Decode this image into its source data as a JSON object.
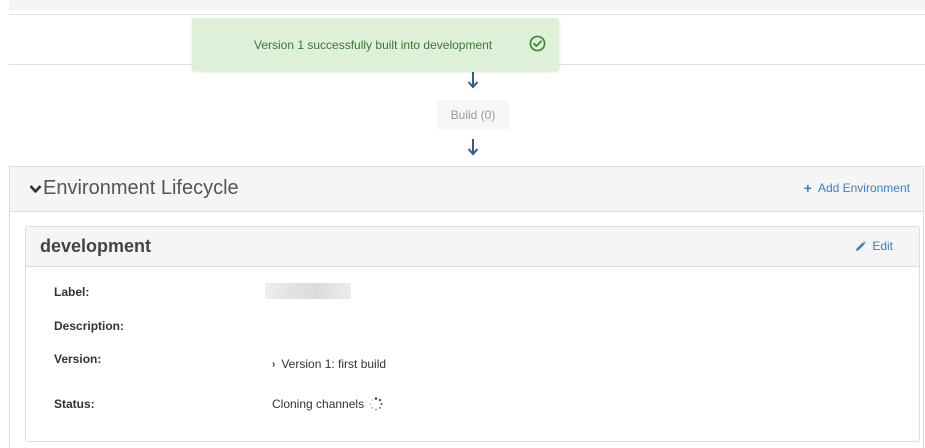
{
  "toast": {
    "message": "Version 1 successfully built into development",
    "icon": "check-circle-icon",
    "color": "#3c763d",
    "background": "#dff0d8"
  },
  "pipeline": {
    "build_label": "Build (0)",
    "arrow_color": "#2e5d8c"
  },
  "lifecycle": {
    "title": "Environment Lifecycle",
    "collapse_icon": "chevron-down-icon",
    "add_environment_label": "Add Environment",
    "add_icon": "plus-icon",
    "link_color": "#3b7fc4"
  },
  "environment": {
    "name": "development",
    "edit_label": "Edit",
    "edit_icon": "pencil-icon",
    "fields": {
      "label_label": "Label:",
      "description_label": "Description:",
      "version_label": "Version:",
      "version_value": "Version 1: first build",
      "status_label": "Status:",
      "status_value": "Cloning channels"
    }
  }
}
